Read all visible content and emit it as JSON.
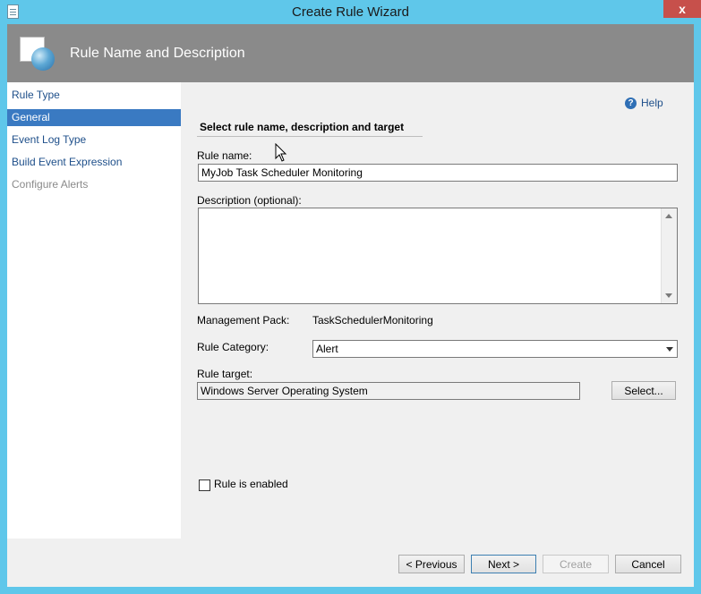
{
  "window": {
    "title": "Create Rule Wizard",
    "close_glyph": "x"
  },
  "header": {
    "title": "Rule Name and Description",
    "icon": "wizard-page-icon"
  },
  "nav": {
    "items": [
      {
        "label": "Rule Type",
        "state": "normal"
      },
      {
        "label": "General",
        "state": "selected"
      },
      {
        "label": "Event Log Type",
        "state": "normal"
      },
      {
        "label": "Build Event Expression",
        "state": "normal"
      },
      {
        "label": "Configure Alerts",
        "state": "disabled"
      }
    ]
  },
  "main": {
    "help_label": "Help",
    "section_title": "Select rule name, description and target",
    "rule_name": {
      "label": "Rule name:",
      "value": "MyJob Task Scheduler Monitoring"
    },
    "description": {
      "label": "Description (optional):",
      "value": ""
    },
    "management_pack": {
      "label": "Management Pack:",
      "value": "TaskSchedulerMonitoring"
    },
    "rule_category": {
      "label": "Rule Category:",
      "value": "Alert"
    },
    "rule_target": {
      "label": "Rule target:",
      "value": "Windows Server Operating System",
      "select_label": "Select..."
    },
    "enabled": {
      "label": "Rule is enabled",
      "checked": false
    }
  },
  "footer": {
    "previous_label": "< Previous",
    "next_label": "Next >",
    "create_label": "Create",
    "cancel_label": "Cancel"
  },
  "colors": {
    "title_bar": "#5fc7ea",
    "header": "#8a8a8a",
    "nav_selected": "#3a7ac2",
    "link": "#1e4f8a"
  }
}
